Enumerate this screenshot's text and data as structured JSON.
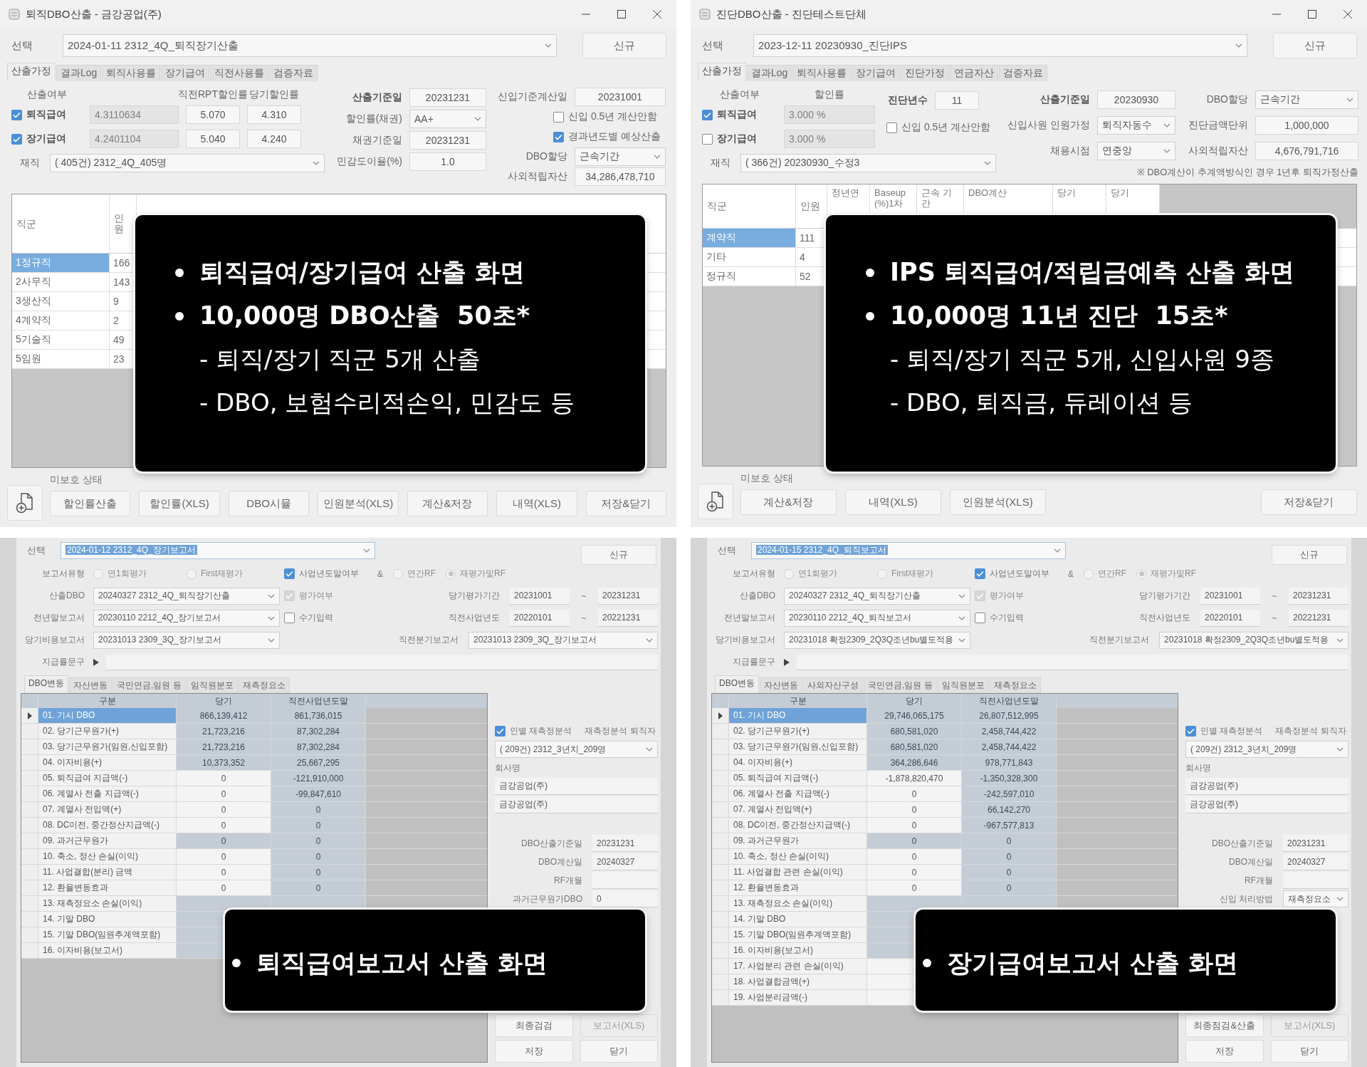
{
  "panels": [
    {
      "kind": "calc",
      "title": "퇴직DBO산출 - 금강공업(주)",
      "select": {
        "label": "선택",
        "value": "2024-01-11 2312_4Q_퇴직장기산출"
      },
      "new_button": "신규",
      "tabs": [
        {
          "label": "산출가정",
          "selected": true
        },
        {
          "label": "결과Log",
          "selected": false
        },
        {
          "label": "퇴직사용률",
          "selected": false
        },
        {
          "label": "장기급여",
          "selected": false
        },
        {
          "label": "직전사용률",
          "selected": false
        },
        {
          "label": "검증자료",
          "selected": false
        }
      ],
      "benefits": {
        "header": [
          "산출여부",
          "직전RPT할인률",
          "당기할인률"
        ],
        "rows": [
          {
            "label": "퇴직급여",
            "checked": true,
            "rates": [
              {
                "value": "4.3110634",
                "disabled": true
              },
              {
                "value": "5.070",
                "disabled": false
              },
              {
                "value": "4.310",
                "disabled": false
              }
            ]
          },
          {
            "label": "장기급여",
            "checked": true,
            "rates": [
              {
                "value": "4.2401104",
                "disabled": true
              },
              {
                "value": "5.040",
                "disabled": false
              },
              {
                "value": "4.240",
                "disabled": false
              }
            ]
          }
        ]
      },
      "enrolled": {
        "label": "재직",
        "value": "( 405건) 2312_4Q_405명"
      },
      "field_groups": [
        [
          {
            "kind": "field",
            "label": "산출기준일",
            "emphasis": true,
            "value": "20231231"
          },
          {
            "kind": "select",
            "label": "할인률(채권)",
            "emphasis": false,
            "value": "AA+"
          },
          {
            "kind": "field",
            "label": "채권기준일",
            "emphasis": false,
            "value": "20231231"
          },
          {
            "kind": "field",
            "label": "민감도이율(%)",
            "emphasis": false,
            "value": "1.0"
          }
        ],
        [
          {
            "kind": "field",
            "label": "신입기준계산일",
            "emphasis": false,
            "value": "20231001"
          },
          {
            "kind": "check",
            "label": "신입 0.5년 계산안함",
            "checked": false
          },
          {
            "kind": "check",
            "label": "경과년도별 예상산출",
            "checked": true
          },
          {
            "kind": "select",
            "label": "DBO할당",
            "emphasis": false,
            "value": "근속기간"
          },
          {
            "kind": "field",
            "label": "사외적립자산",
            "emphasis": false,
            "value": "34,286,478,710"
          }
        ]
      ],
      "grid": {
        "columns": [
          "직군",
          "인원"
        ],
        "rows": [
          {
            "cells": [
              "1정규직",
              "166"
            ],
            "selected": true
          },
          {
            "cells": [
              "2사무직",
              "143"
            ],
            "selected": false
          },
          {
            "cells": [
              "3생산직",
              "9"
            ],
            "selected": false
          },
          {
            "cells": [
              "4계약직",
              "2"
            ],
            "selected": false
          },
          {
            "cells": [
              "5기술직",
              "49"
            ],
            "selected": false
          },
          {
            "cells": [
              "5임원",
              "23"
            ],
            "selected": false
          }
        ]
      },
      "status": "미보호 상태",
      "buttons": [
        "할인률산출",
        "할인률(XLS)",
        "DBO시뮬",
        "인원분석(XLS)",
        "계산&저장",
        "내역(XLS)",
        "저장&닫기"
      ],
      "caption": [
        {
          "kind": "bullet",
          "text": "퇴직급여/장기급여 산출 화면"
        },
        {
          "kind": "bullet",
          "text": "10,000명 DBO산출  50초*"
        },
        {
          "kind": "dash",
          "text": "- 퇴직/장기 직군 5개 산출"
        },
        {
          "kind": "dash",
          "text": "- DBO, 보험수리적손익, 민감도 등"
        }
      ]
    },
    {
      "kind": "diagnosis",
      "title": "진단DBO산출 - 진단테스트단체",
      "select": {
        "label": "선택",
        "value": "2023-12-11 20230930_진단IPS"
      },
      "new_button": "신규",
      "tabs": [
        {
          "label": "산출가정",
          "selected": true
        },
        {
          "label": "결과Log",
          "selected": false
        },
        {
          "label": "퇴직사용률",
          "selected": false
        },
        {
          "label": "장기급여",
          "selected": false
        },
        {
          "label": "진단가정",
          "selected": false
        },
        {
          "label": "연금자산",
          "selected": false
        },
        {
          "label": "검증자료",
          "selected": false
        }
      ],
      "benefits": {
        "header": [
          "산출여부",
          "할인률"
        ],
        "rows": [
          {
            "label": "퇴직급여",
            "checked": true,
            "rates": [
              {
                "value": "3.000 %",
                "disabled": true
              }
            ]
          },
          {
            "label": "장기급여",
            "checked": false,
            "rates": [
              {
                "value": "3.000 %",
                "disabled": true
              }
            ]
          }
        ]
      },
      "enrolled": {
        "label": "재직",
        "value": "( 366건) 20230930_수정3"
      },
      "field_groups": [
        [
          {
            "kind": "field",
            "label": "진단년수",
            "emphasis": true,
            "value": "11"
          },
          {
            "kind": "check",
            "label": "신입 0.5년 계산안함",
            "checked": false
          }
        ],
        [
          {
            "kind": "field",
            "label": "산출기준일",
            "emphasis": true,
            "value": "20230930"
          },
          {
            "kind": "select",
            "label": "신입사원 인원가정",
            "emphasis": false,
            "value": "퇴직자동수"
          },
          {
            "kind": "select",
            "label": "채용시점",
            "emphasis": false,
            "value": "연중앙"
          }
        ],
        [
          {
            "kind": "select",
            "label": "DBO할당",
            "emphasis": false,
            "value": "근속기간"
          },
          {
            "kind": "field",
            "label": "진단금액단위",
            "emphasis": false,
            "value": "1,000,000"
          },
          {
            "kind": "field",
            "label": "사외적립자산",
            "emphasis": false,
            "value": "4,676,791,716"
          }
        ]
      ],
      "note": "※ DBO계산이 추계액방식인 경우 1년후 퇴직가정산출",
      "grid": {
        "columns": [
          "직군",
          "인원",
          "정년연",
          "Baseup (%)1차",
          "근속 기간",
          "DBO계산",
          "당기",
          "당기"
        ],
        "rows": [
          {
            "cells": [
              "계약직",
              "111"
            ],
            "selected": true
          },
          {
            "cells": [
              "기타",
              "4"
            ],
            "selected": false
          },
          {
            "cells": [
              "정규직",
              "52"
            ],
            "selected": false
          }
        ]
      },
      "status": "미보호 상태",
      "buttons": [
        "계산&저장",
        "내역(XLS)",
        "인원분석(XLS)",
        "저장&닫기"
      ],
      "caption": [
        {
          "kind": "bullet",
          "text": "IPS 퇴직급여/적립금예측 산출 화면"
        },
        {
          "kind": "bullet",
          "text": "10,000명 11년 진단  15초*"
        },
        {
          "kind": "dash",
          "text": "- 퇴직/장기 직군 5개, 신입사원 9종"
        },
        {
          "kind": "dash",
          "text": "- DBO, 퇴직금, 듀레이션 등"
        }
      ]
    },
    {
      "kind": "report",
      "select": {
        "label": "선택",
        "value": "2024-01-12 2312_4Q_장기보고서"
      },
      "new_button": "신규",
      "form_rows": [
        {
          "left": [
            {
              "kind": "label",
              "text": "보고서유형"
            },
            {
              "kind": "radio",
              "label": "연1회평가",
              "selected": false,
              "disabled": true
            },
            {
              "kind": "radio",
              "label": "First재평가",
              "selected": false,
              "disabled": true
            },
            {
              "kind": "check",
              "label": "사업년도말여부",
              "checked": true,
              "disabled": false
            },
            {
              "kind": "text",
              "text": "&"
            },
            {
              "kind": "radio",
              "label": "연간RF",
              "selected": false,
              "disabled": true
            },
            {
              "kind": "radio",
              "label": "재평가및RF",
              "selected": true,
              "disabled": true
            }
          ]
        },
        {
          "left": [
            {
              "kind": "label",
              "text": "산출DBO"
            },
            {
              "kind": "select",
              "value": "20240327 2312_4Q_퇴직장기산출"
            },
            {
              "kind": "check",
              "label": "평가여부",
              "checked": true,
              "disabled": true
            }
          ],
          "right": [
            {
              "kind": "label",
              "text": "당기평가기간"
            },
            {
              "kind": "field",
              "value": "20231001"
            },
            {
              "kind": "text",
              "text": "~"
            },
            {
              "kind": "field",
              "value": "20231231"
            }
          ]
        },
        {
          "left": [
            {
              "kind": "label",
              "text": "전년말보고서"
            },
            {
              "kind": "select",
              "value": "20230110 2212_4Q_장기보고서"
            },
            {
              "kind": "check",
              "label": "수기입력",
              "checked": false,
              "disabled": false
            }
          ],
          "right": [
            {
              "kind": "label",
              "text": "직전사업년도"
            },
            {
              "kind": "field",
              "value": "20220101"
            },
            {
              "kind": "text",
              "text": "~"
            },
            {
              "kind": "field",
              "value": "20221231"
            }
          ]
        },
        {
          "left": [
            {
              "kind": "label",
              "text": "당기비용보고서"
            },
            {
              "kind": "select",
              "value": "20231013 2309_3Q_장기보고서"
            }
          ],
          "right": [
            {
              "kind": "label",
              "text": "직전분기보고서"
            },
            {
              "kind": "select",
              "value": "20231013 2309_3Q_장기보고서"
            }
          ]
        }
      ],
      "memo": {
        "label": "지급률문구"
      },
      "tabs": [
        {
          "label": "DBO변동",
          "selected": true
        },
        {
          "label": "자산변동",
          "selected": false
        },
        {
          "label": "국민연금,임원 등",
          "selected": false
        },
        {
          "label": "임직원분포",
          "selected": false
        },
        {
          "label": "재측정요소",
          "selected": false
        }
      ],
      "grid": {
        "columns": [
          "구분",
          "당기",
          "직전사업년도말"
        ],
        "rows": [
          {
            "label": "01. 기시 DBO",
            "current": "866,139,412",
            "prior": "861,736,015",
            "current_shaded": true,
            "prior_shaded": true,
            "selected": true
          },
          {
            "label": "02. 당기근무원가(+)",
            "current": "21,723,216",
            "prior": "87,302,284",
            "current_shaded": true,
            "prior_shaded": true,
            "selected": false
          },
          {
            "label": "03. 당기근무원가(임원,신입포함)",
            "current": "21,723,216",
            "prior": "87,302,284",
            "current_shaded": true,
            "prior_shaded": true,
            "selected": false
          },
          {
            "label": "04. 이자비용(+)",
            "current": "10,373,352",
            "prior": "25,667,295",
            "current_shaded": true,
            "prior_shaded": true,
            "selected": false
          },
          {
            "label": "05. 퇴직급여 지급액(-)",
            "current": "0",
            "prior": "-121,910,000",
            "current_shaded": false,
            "prior_shaded": true,
            "selected": false
          },
          {
            "label": "06. 계열사 전출 지급액(-)",
            "current": "0",
            "prior": "-99,847,610",
            "current_shaded": false,
            "prior_shaded": true,
            "selected": false
          },
          {
            "label": "07. 계열사 전입액(+)",
            "current": "0",
            "prior": "0",
            "current_shaded": false,
            "prior_shaded": true,
            "selected": false
          },
          {
            "label": "08. DC이전, 중간정산지급액(-)",
            "current": "0",
            "prior": "0",
            "current_shaded": false,
            "prior_shaded": true,
            "selected": false
          },
          {
            "label": "09. 과거근무원가",
            "current": "0",
            "prior": "0",
            "current_shaded": true,
            "prior_shaded": true,
            "selected": false
          },
          {
            "label": "10. 축소, 정산 손실(이익)",
            "current": "0",
            "prior": "0",
            "current_shaded": false,
            "prior_shaded": true,
            "selected": false
          },
          {
            "label": "11. 사업결합(분리) 금액",
            "current": "0",
            "prior": "0",
            "current_shaded": false,
            "prior_shaded": true,
            "selected": false
          },
          {
            "label": "12. 환율변동효과",
            "current": "0",
            "prior": "0",
            "current_shaded": false,
            "prior_shaded": true,
            "selected": false
          },
          {
            "label": "13. 재측정요소 손실(이익)",
            "current_shaded": true,
            "prior_shaded": true,
            "selected": false
          },
          {
            "label": "14. 기말 DBO",
            "current_shaded": true,
            "selected": false
          },
          {
            "label": "15. 기말 DBO(임원추계액포함)",
            "current_shaded": true,
            "selected": false
          },
          {
            "label": "16. 이자비용(보고서)",
            "current_shaded": true,
            "selected": false
          }
        ]
      },
      "side": [
        [
          {
            "kind": "check",
            "label": "인별 재측정분석",
            "checked": true,
            "disabled": false
          },
          {
            "kind": "label",
            "text": "재측정분석 퇴직자"
          }
        ],
        [
          {
            "kind": "select",
            "value": "( 209건) 2312_3년치_209명"
          }
        ],
        [
          {
            "kind": "label",
            "text": "회사명"
          }
        ],
        [
          {
            "kind": "field",
            "value": "금강공업(주)"
          }
        ],
        [
          {
            "kind": "field",
            "value": "금강공업(주)"
          }
        ],
        [
          {
            "kind": "label",
            "text": "DBO산출기준일"
          },
          {
            "kind": "field",
            "value": "20231231"
          }
        ],
        [
          {
            "kind": "label",
            "text": "DBO계산일"
          },
          {
            "kind": "field",
            "value": "20240327"
          }
        ],
        [
          {
            "kind": "label",
            "text": "RF개월"
          },
          {
            "kind": "field"
          }
        ],
        [
          {
            "kind": "label",
            "text": "과거근무원가DBO"
          },
          {
            "kind": "field",
            "value": "0"
          }
        ]
      ],
      "buttons": [
        {
          "label": "최종검검",
          "disabled": false
        },
        {
          "label": "보고서(XLS)",
          "disabled": true
        },
        {
          "label": "저장",
          "disabled": false
        },
        {
          "label": "닫기",
          "disabled": false
        }
      ],
      "caption": [
        {
          "kind": "bullet",
          "text": "퇴직급여보고서 산출 화면"
        }
      ]
    },
    {
      "kind": "report",
      "select": {
        "label": "선택",
        "value": "2024-01-15 2312_4Q_퇴직보고서"
      },
      "new_button": "신규",
      "form_rows": [
        {
          "left": [
            {
              "kind": "label",
              "text": "보고서유형"
            },
            {
              "kind": "radio",
              "label": "연1회평가",
              "selected": false,
              "disabled": true
            },
            {
              "kind": "radio",
              "label": "First재평가",
              "selected": false,
              "disabled": true
            },
            {
              "kind": "check",
              "label": "사업년도말여부",
              "checked": true,
              "disabled": false
            },
            {
              "kind": "text",
              "text": "&"
            },
            {
              "kind": "radio",
              "label": "연간RF",
              "selected": false,
              "disabled": true
            },
            {
              "kind": "radio",
              "label": "재평가및RF",
              "selected": true,
              "disabled": true
            }
          ]
        },
        {
          "left": [
            {
              "kind": "label",
              "text": "산출DBO"
            },
            {
              "kind": "select",
              "value": "20240327 2312_4Q_퇴직장기산출"
            },
            {
              "kind": "check",
              "label": "평가여부",
              "checked": true,
              "disabled": true
            }
          ],
          "right": [
            {
              "kind": "label",
              "text": "당기평가기간"
            },
            {
              "kind": "field",
              "value": "20231001"
            },
            {
              "kind": "text",
              "text": "~"
            },
            {
              "kind": "field",
              "value": "20231231"
            }
          ]
        },
        {
          "left": [
            {
              "kind": "label",
              "text": "전년말보고서"
            },
            {
              "kind": "select",
              "value": "20230110 2212_4Q_퇴직보고서"
            },
            {
              "kind": "check",
              "label": "수기입력",
              "checked": false,
              "disabled": false
            }
          ],
          "right": [
            {
              "kind": "label",
              "text": "직전사업년도"
            },
            {
              "kind": "field",
              "value": "20220101"
            },
            {
              "kind": "text",
              "text": "~"
            },
            {
              "kind": "field",
              "value": "20221231"
            }
          ]
        },
        {
          "left": [
            {
              "kind": "label",
              "text": "당기비용보고서"
            },
            {
              "kind": "select",
              "value": "20231018 확정2309_2Q3Q조년bu별도적용"
            }
          ],
          "right": [
            {
              "kind": "label",
              "text": "직전분기보고서"
            },
            {
              "kind": "select",
              "value": "20231018 확정2309_2Q3Q조년bu별도적용"
            }
          ]
        }
      ],
      "memo": {
        "label": "지급률문구"
      },
      "tabs": [
        {
          "label": "DBO변동",
          "selected": true
        },
        {
          "label": "자산변동",
          "selected": false
        },
        {
          "label": "사외자산구성",
          "selected": false
        },
        {
          "label": "국민연금,임원 등",
          "selected": false
        },
        {
          "label": "임직원분포",
          "selected": false
        },
        {
          "label": "재측정요소",
          "selected": false
        }
      ],
      "grid": {
        "columns": [
          "구분",
          "당기",
          "직전사업년도말"
        ],
        "rows": [
          {
            "label": "01. 기시 DBO",
            "current": "29,746,065,175",
            "prior": "26,807,512,995",
            "current_shaded": true,
            "prior_shaded": true,
            "selected": true
          },
          {
            "label": "02. 당기근무원가(+)",
            "current": "680,581,020",
            "prior": "2,458,744,422",
            "current_shaded": true,
            "prior_shaded": true,
            "selected": false
          },
          {
            "label": "03. 당기근무원가(임원,신입포함)",
            "current": "680,581,020",
            "prior": "2,458,744,422",
            "current_shaded": true,
            "prior_shaded": true,
            "selected": false
          },
          {
            "label": "04. 이자비용(+)",
            "current": "364,286,646",
            "prior": "978,771,843",
            "current_shaded": true,
            "prior_shaded": true,
            "selected": false
          },
          {
            "label": "05. 퇴직급여 지급액(-)",
            "current": "-1,878,820,470",
            "prior": "-1,350,328,300",
            "current_shaded": false,
            "prior_shaded": true,
            "selected": false
          },
          {
            "label": "06. 계열사 전출 지급액(-)",
            "current": "0",
            "prior": "-242,597,010",
            "current_shaded": false,
            "prior_shaded": true,
            "selected": false
          },
          {
            "label": "07. 계열사 전입액(+)",
            "current": "0",
            "prior": "66,142,270",
            "current_shaded": false,
            "prior_shaded": true,
            "selected": false
          },
          {
            "label": "08. DC이전, 중간정산지급액(-)",
            "current": "0",
            "prior": "-967,577,813",
            "current_shaded": false,
            "prior_shaded": true,
            "selected": false
          },
          {
            "label": "09. 과거근무원가",
            "current": "0",
            "prior": "0",
            "current_shaded": true,
            "prior_shaded": true,
            "selected": false
          },
          {
            "label": "10. 축소, 정산 손실(이익)",
            "current": "0",
            "prior": "0",
            "current_shaded": false,
            "prior_shaded": true,
            "selected": false
          },
          {
            "label": "11. 사업결합 관련 손실(이익)",
            "current": "0",
            "prior": "0",
            "current_shaded": false,
            "prior_shaded": true,
            "selected": false
          },
          {
            "label": "12. 환율변동효과",
            "current": "0",
            "prior": "0",
            "current_shaded": false,
            "prior_shaded": true,
            "selected": false
          },
          {
            "label": "13. 재측정요소 손실(이익)",
            "current_shaded": true,
            "prior_shaded": true,
            "selected": false
          },
          {
            "label": "14. 기말 DBO",
            "current_shaded": true,
            "selected": false
          },
          {
            "label": "15. 기말 DBO(임원추계액포함)",
            "current_shaded": true,
            "selected": false
          },
          {
            "label": "16. 이자비용(보고서)",
            "current_shaded": true,
            "selected": false
          },
          {
            "label": "17. 사업분리 관련 손실(이익)",
            "current_shaded": false,
            "selected": false
          },
          {
            "label": "18. 사업결합금액(+)",
            "current_shaded": false,
            "selected": false
          },
          {
            "label": "19. 사업분리금액(-)",
            "current_shaded": false,
            "selected": false
          }
        ]
      },
      "side": [
        [
          {
            "kind": "check",
            "label": "인별 재측정분석",
            "checked": true,
            "disabled": false
          },
          {
            "kind": "label",
            "text": "재측정분석 퇴직자"
          }
        ],
        [
          {
            "kind": "select",
            "value": "( 209건) 2312_3년치_209명"
          }
        ],
        [
          {
            "kind": "label",
            "text": "회사명"
          }
        ],
        [
          {
            "kind": "field",
            "value": "금강공업(주)"
          }
        ],
        [
          {
            "kind": "field",
            "value": "금강공업(주)"
          }
        ],
        [
          {
            "kind": "label",
            "text": "DBO산출기준일"
          },
          {
            "kind": "field",
            "value": "20231231"
          }
        ],
        [
          {
            "kind": "label",
            "text": "DBO계산일"
          },
          {
            "kind": "field",
            "value": "20240327"
          }
        ],
        [
          {
            "kind": "label",
            "text": "RF개월"
          },
          {
            "kind": "field"
          }
        ],
        [
          {
            "kind": "label",
            "text": "신입 처리방법"
          },
          {
            "kind": "select",
            "value": "재측정요소"
          }
        ]
      ],
      "buttons": [
        {
          "label": "최종점검&산출",
          "disabled": false
        },
        {
          "label": "보고서(XLS)",
          "disabled": true
        },
        {
          "label": "저장",
          "disabled": false
        },
        {
          "label": "닫기",
          "disabled": false
        }
      ],
      "caption": [
        {
          "kind": "bullet",
          "text": "장기급여보고서 산출 화면"
        }
      ]
    }
  ]
}
